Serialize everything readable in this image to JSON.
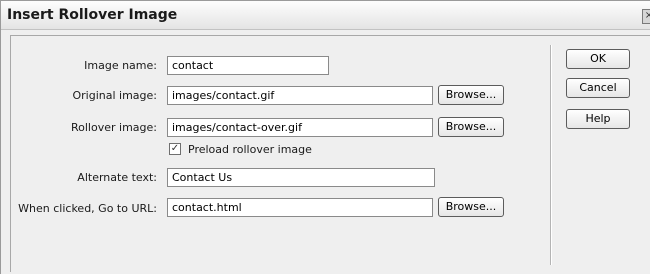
{
  "window": {
    "title": "Insert Rollover Image",
    "close_glyph": "×"
  },
  "form": {
    "image_name": {
      "label": "Image name:",
      "value": "contact"
    },
    "original_image": {
      "label": "Original image:",
      "value": "images/contact.gif",
      "browse_label": "Browse..."
    },
    "rollover_image": {
      "label": "Rollover image:",
      "value": "images/contact-over.gif",
      "browse_label": "Browse..."
    },
    "preload": {
      "label": "Preload rollover image",
      "checked": true,
      "check_glyph": "✓"
    },
    "alternate_text": {
      "label": "Alternate text:",
      "value": "Contact Us"
    },
    "go_to_url": {
      "label": "When clicked, Go to URL:",
      "value": "contact.html",
      "browse_label": "Browse..."
    }
  },
  "buttons": {
    "ok": "OK",
    "cancel": "Cancel",
    "help": "Help"
  }
}
